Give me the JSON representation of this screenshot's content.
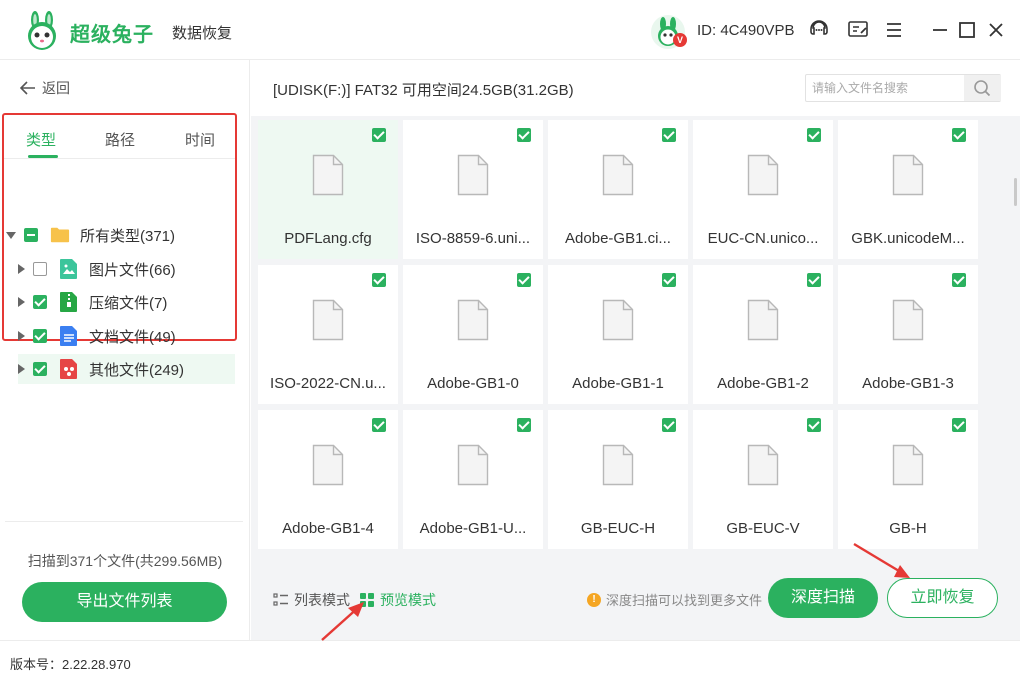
{
  "app": {
    "name": "超级兔子",
    "subtitle": "数据恢复",
    "user_id": "ID: 4C490VPB",
    "vip_badge": "V"
  },
  "titlebar_icons": [
    "support-icon",
    "feedback-icon",
    "menu-icon",
    "minimize-icon",
    "maximize-icon",
    "close-icon"
  ],
  "left": {
    "back_label": "返回",
    "tabs": [
      {
        "label": "类型",
        "active": true
      },
      {
        "label": "路径",
        "active": false
      },
      {
        "label": "时间",
        "active": false
      }
    ],
    "tree": {
      "root": {
        "label": "所有类型(371)",
        "checked": "partial",
        "expanded": true
      },
      "children": [
        {
          "label": "图片文件(66)",
          "checked": false,
          "icon": "image-file-icon",
          "color": "#3cc59b"
        },
        {
          "label": "压缩文件(7)",
          "checked": true,
          "icon": "archive-file-icon",
          "color": "#27a745"
        },
        {
          "label": "文档文件(49)",
          "checked": true,
          "icon": "document-file-icon",
          "color": "#3b7ff1"
        },
        {
          "label": "其他文件(249)",
          "checked": true,
          "icon": "other-file-icon",
          "color": "#e64545",
          "selected": true
        }
      ]
    },
    "scan_summary": "扫描到371个文件(共299.56MB)",
    "export_label": "导出文件列表"
  },
  "main": {
    "disk_info": "[UDISK(F:)] FAT32 可用空间24.5GB(31.2GB)",
    "search_placeholder": "请输入文件名搜索",
    "files": [
      {
        "name": "PDFLang.cfg",
        "checked": true,
        "active": true
      },
      {
        "name": "ISO-8859-6.uni...",
        "checked": true
      },
      {
        "name": "Adobe-GB1.ci...",
        "checked": true
      },
      {
        "name": "EUC-CN.unico...",
        "checked": true
      },
      {
        "name": "GBK.unicodeM...",
        "checked": true
      },
      {
        "name": "ISO-2022-CN.u...",
        "checked": true
      },
      {
        "name": "Adobe-GB1-0",
        "checked": true
      },
      {
        "name": "Adobe-GB1-1",
        "checked": true
      },
      {
        "name": "Adobe-GB1-2",
        "checked": true
      },
      {
        "name": "Adobe-GB1-3",
        "checked": true
      },
      {
        "name": "Adobe-GB1-4",
        "checked": true
      },
      {
        "name": "Adobe-GB1-U...",
        "checked": true
      },
      {
        "name": "GB-EUC-H",
        "checked": true
      },
      {
        "name": "GB-EUC-V",
        "checked": true
      },
      {
        "name": "GB-H",
        "checked": true
      }
    ],
    "list_mode_label": "列表模式",
    "preview_mode_label": "预览模式",
    "hint": "深度扫描可以找到更多文件",
    "hint_icon": "!",
    "deep_scan_label": "深度扫描",
    "recover_label": "立即恢复"
  },
  "footer": {
    "version": "版本号：2.22.28.970"
  },
  "colors": {
    "accent": "#2bb15f",
    "annotation": "#e53935"
  }
}
